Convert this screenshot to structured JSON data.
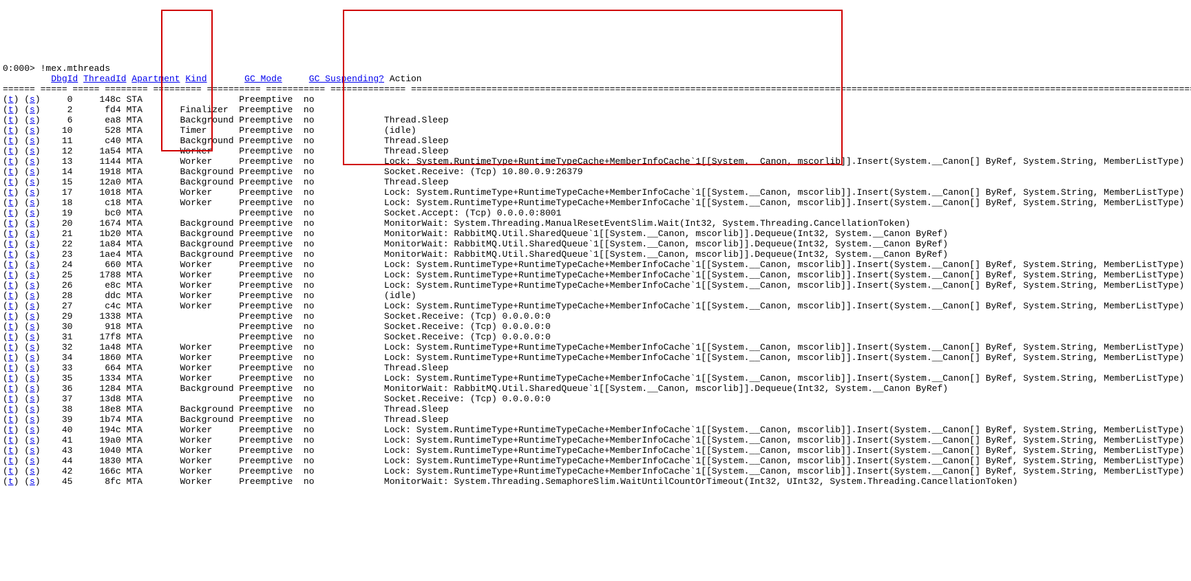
{
  "prompt": "0:000> ",
  "command": "!mex.mthreads",
  "header": {
    "ts_pad": "         ",
    "dbgid": "DbgId",
    "threadid": "ThreadId",
    "apartment": "Apartment",
    "kind": "Kind",
    "gc_mode": "GC_Mode",
    "gc_suspending": "GC_Suspending?",
    "action": "Action"
  },
  "sep": {
    "ts": "====== ===== ",
    "dbgid": "=====",
    "threadid": "========",
    "apt": "=========",
    "kind": "==========",
    "gc": "===========",
    "susp": "==============",
    "action": "================================================================================================================================================================================================================"
  },
  "link_t": "t",
  "link_s": "s",
  "lock_text": "Lock: System.RuntimeType+RuntimeTypeCache+MemberInfoCache`1[[System.__Canon, mscorlib]].Insert(System.__Canon[] ByRef, System.String, MemberListType)",
  "rabbit_text": "MonitorWait: RabbitMQ.Util.SharedQueue`1[[System.__Canon, mscorlib]].Dequeue(Int32, System.__Canon ByRef)",
  "rows": [
    {
      "dbg": "0",
      "tid": "148c",
      "apt": "STA",
      "kind": "",
      "gc": "Preemptive",
      "susp": "no",
      "action": ""
    },
    {
      "dbg": "2",
      "tid": "fd4",
      "apt": "MTA",
      "kind": "Finalizer",
      "gc": "Preemptive",
      "susp": "no",
      "action": ""
    },
    {
      "dbg": "6",
      "tid": "ea8",
      "apt": "MTA",
      "kind": "Background",
      "gc": "Preemptive",
      "susp": "no",
      "action": "Thread.Sleep"
    },
    {
      "dbg": "10",
      "tid": "528",
      "apt": "MTA",
      "kind": "Timer",
      "gc": "Preemptive",
      "susp": "no",
      "action": "(idle)"
    },
    {
      "dbg": "11",
      "tid": "c40",
      "apt": "MTA",
      "kind": "Background",
      "gc": "Preemptive",
      "susp": "no",
      "action": "Thread.Sleep"
    },
    {
      "dbg": "12",
      "tid": "1a54",
      "apt": "MTA",
      "kind": "Worker",
      "gc": "Preemptive",
      "susp": "no",
      "action": "Thread.Sleep"
    },
    {
      "dbg": "13",
      "tid": "1144",
      "apt": "MTA",
      "kind": "Worker",
      "gc": "Preemptive",
      "susp": "no",
      "action": "LOCK"
    },
    {
      "dbg": "14",
      "tid": "1918",
      "apt": "MTA",
      "kind": "Background",
      "gc": "Preemptive",
      "susp": "no",
      "action": "Socket.Receive: (Tcp) 10.80.0.9:26379"
    },
    {
      "dbg": "15",
      "tid": "12a0",
      "apt": "MTA",
      "kind": "Background",
      "gc": "Preemptive",
      "susp": "no",
      "action": "Thread.Sleep"
    },
    {
      "dbg": "17",
      "tid": "1018",
      "apt": "MTA",
      "kind": "Worker",
      "gc": "Preemptive",
      "susp": "no",
      "action": "LOCK"
    },
    {
      "dbg": "18",
      "tid": "c18",
      "apt": "MTA",
      "kind": "Worker",
      "gc": "Preemptive",
      "susp": "no",
      "action": "LOCK"
    },
    {
      "dbg": "19",
      "tid": "bc0",
      "apt": "MTA",
      "kind": "",
      "gc": "Preemptive",
      "susp": "no",
      "action": "Socket.Accept: (Tcp) 0.0.0.0:8001"
    },
    {
      "dbg": "20",
      "tid": "1674",
      "apt": "MTA",
      "kind": "Background",
      "gc": "Preemptive",
      "susp": "no",
      "action": "MonitorWait: System.Threading.ManualResetEventSlim.Wait(Int32, System.Threading.CancellationToken)"
    },
    {
      "dbg": "21",
      "tid": "1b20",
      "apt": "MTA",
      "kind": "Background",
      "gc": "Preemptive",
      "susp": "no",
      "action": "RABBIT"
    },
    {
      "dbg": "22",
      "tid": "1a84",
      "apt": "MTA",
      "kind": "Background",
      "gc": "Preemptive",
      "susp": "no",
      "action": "RABBIT"
    },
    {
      "dbg": "23",
      "tid": "1ae4",
      "apt": "MTA",
      "kind": "Background",
      "gc": "Preemptive",
      "susp": "no",
      "action": "RABBIT"
    },
    {
      "dbg": "24",
      "tid": "660",
      "apt": "MTA",
      "kind": "Worker",
      "gc": "Preemptive",
      "susp": "no",
      "action": "LOCK"
    },
    {
      "dbg": "25",
      "tid": "1788",
      "apt": "MTA",
      "kind": "Worker",
      "gc": "Preemptive",
      "susp": "no",
      "action": "LOCK"
    },
    {
      "dbg": "26",
      "tid": "e8c",
      "apt": "MTA",
      "kind": "Worker",
      "gc": "Preemptive",
      "susp": "no",
      "action": "LOCK"
    },
    {
      "dbg": "28",
      "tid": "ddc",
      "apt": "MTA",
      "kind": "Worker",
      "gc": "Preemptive",
      "susp": "no",
      "action": "(idle)"
    },
    {
      "dbg": "27",
      "tid": "c4c",
      "apt": "MTA",
      "kind": "Worker",
      "gc": "Preemptive",
      "susp": "no",
      "action": "LOCK"
    },
    {
      "dbg": "29",
      "tid": "1338",
      "apt": "MTA",
      "kind": "",
      "gc": "Preemptive",
      "susp": "no",
      "action": "Socket.Receive: (Tcp) 0.0.0.0:0"
    },
    {
      "dbg": "30",
      "tid": "918",
      "apt": "MTA",
      "kind": "",
      "gc": "Preemptive",
      "susp": "no",
      "action": "Socket.Receive: (Tcp) 0.0.0.0:0"
    },
    {
      "dbg": "31",
      "tid": "17f8",
      "apt": "MTA",
      "kind": "",
      "gc": "Preemptive",
      "susp": "no",
      "action": "Socket.Receive: (Tcp) 0.0.0.0:0"
    },
    {
      "dbg": "32",
      "tid": "1a48",
      "apt": "MTA",
      "kind": "Worker",
      "gc": "Preemptive",
      "susp": "no",
      "action": "LOCK"
    },
    {
      "dbg": "34",
      "tid": "1860",
      "apt": "MTA",
      "kind": "Worker",
      "gc": "Preemptive",
      "susp": "no",
      "action": "LOCK"
    },
    {
      "dbg": "33",
      "tid": "664",
      "apt": "MTA",
      "kind": "Worker",
      "gc": "Preemptive",
      "susp": "no",
      "action": "Thread.Sleep"
    },
    {
      "dbg": "35",
      "tid": "1334",
      "apt": "MTA",
      "kind": "Worker",
      "gc": "Preemptive",
      "susp": "no",
      "action": "LOCK"
    },
    {
      "dbg": "36",
      "tid": "1284",
      "apt": "MTA",
      "kind": "Background",
      "gc": "Preemptive",
      "susp": "no",
      "action": "RABBIT"
    },
    {
      "dbg": "37",
      "tid": "13d8",
      "apt": "MTA",
      "kind": "",
      "gc": "Preemptive",
      "susp": "no",
      "action": "Socket.Receive: (Tcp) 0.0.0.0:0"
    },
    {
      "dbg": "38",
      "tid": "18e8",
      "apt": "MTA",
      "kind": "Background",
      "gc": "Preemptive",
      "susp": "no",
      "action": "Thread.Sleep"
    },
    {
      "dbg": "39",
      "tid": "1b74",
      "apt": "MTA",
      "kind": "Background",
      "gc": "Preemptive",
      "susp": "no",
      "action": "Thread.Sleep"
    },
    {
      "dbg": "40",
      "tid": "194c",
      "apt": "MTA",
      "kind": "Worker",
      "gc": "Preemptive",
      "susp": "no",
      "action": "LOCK"
    },
    {
      "dbg": "41",
      "tid": "19a0",
      "apt": "MTA",
      "kind": "Worker",
      "gc": "Preemptive",
      "susp": "no",
      "action": "LOCK"
    },
    {
      "dbg": "43",
      "tid": "1040",
      "apt": "MTA",
      "kind": "Worker",
      "gc": "Preemptive",
      "susp": "no",
      "action": "LOCK"
    },
    {
      "dbg": "44",
      "tid": "1830",
      "apt": "MTA",
      "kind": "Worker",
      "gc": "Preemptive",
      "susp": "no",
      "action": "LOCK"
    },
    {
      "dbg": "42",
      "tid": "166c",
      "apt": "MTA",
      "kind": "Worker",
      "gc": "Preemptive",
      "susp": "no",
      "action": "LOCK"
    },
    {
      "dbg": "45",
      "tid": "8fc",
      "apt": "MTA",
      "kind": "Worker",
      "gc": "Preemptive",
      "susp": "no",
      "action": "MonitorWait: System.Threading.SemaphoreSlim.WaitUntilCountOrTimeout(Int32, UInt32, System.Threading.CancellationToken)"
    }
  ]
}
